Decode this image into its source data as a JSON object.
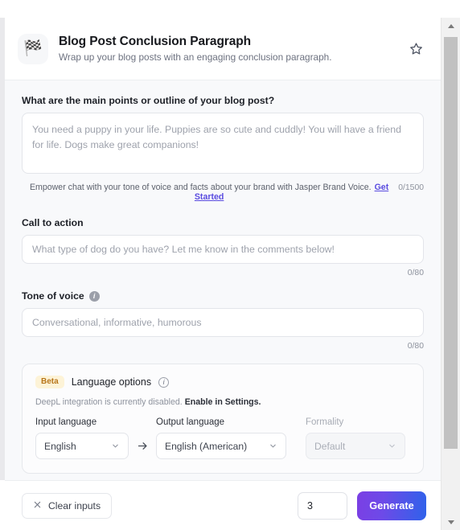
{
  "header": {
    "icon": "checkered-flag-icon",
    "icon_glyph": "🏁",
    "title": "Blog Post Conclusion Paragraph",
    "subtitle": "Wrap up your blog posts with an engaging conclusion paragraph.",
    "favorite_icon": "star-icon"
  },
  "fields": {
    "main_points": {
      "label": "What are the main points or outline of your blog post?",
      "placeholder": "You need a puppy in your life. Puppies are so cute and cuddly! You will have a friend for life. Dogs make great companions!",
      "value": "",
      "counter": "0/1500",
      "note": "Empower chat with your tone of voice and facts about your brand with Jasper Brand Voice.",
      "note_link": "Get Started"
    },
    "call_to_action": {
      "label": "Call to action",
      "placeholder": "What type of dog do you have? Let me know in the comments below!",
      "value": "",
      "counter": "0/80"
    },
    "tone_of_voice": {
      "label": "Tone of voice",
      "info_icon": "info-icon",
      "placeholder": "Conversational, informative, humorous",
      "value": "",
      "counter": "0/80"
    }
  },
  "language_options": {
    "badge": "Beta",
    "title": "Language options",
    "info_icon": "info-icon",
    "notice_text": "DeepL integration is currently disabled.",
    "notice_strong": "Enable in Settings.",
    "input_language": {
      "label": "Input language",
      "value": "English",
      "chevron_icon": "chevron-down-icon"
    },
    "arrow_icon": "arrow-right-icon",
    "output_language": {
      "label": "Output language",
      "value": "English (American)",
      "chevron_icon": "chevron-down-icon"
    },
    "formality": {
      "label": "Formality",
      "value": "Default",
      "chevron_icon": "chevron-down-icon",
      "disabled": true
    }
  },
  "footer": {
    "clear_icon": "close-x-icon",
    "clear_label": "Clear inputs",
    "output_count": "3",
    "generate_label": "Generate"
  },
  "scrollbar": {
    "up_icon": "triangle-up-icon",
    "down_icon": "triangle-down-icon"
  },
  "colors": {
    "accent_purple": "#5a4ce0",
    "generate_gradient_start": "#7b3fe4",
    "generate_gradient_end": "#2f62ea",
    "beta_badge_bg": "#fdf3d7",
    "beta_badge_text": "#b8761a",
    "body_bg": "#f8f9fb"
  }
}
